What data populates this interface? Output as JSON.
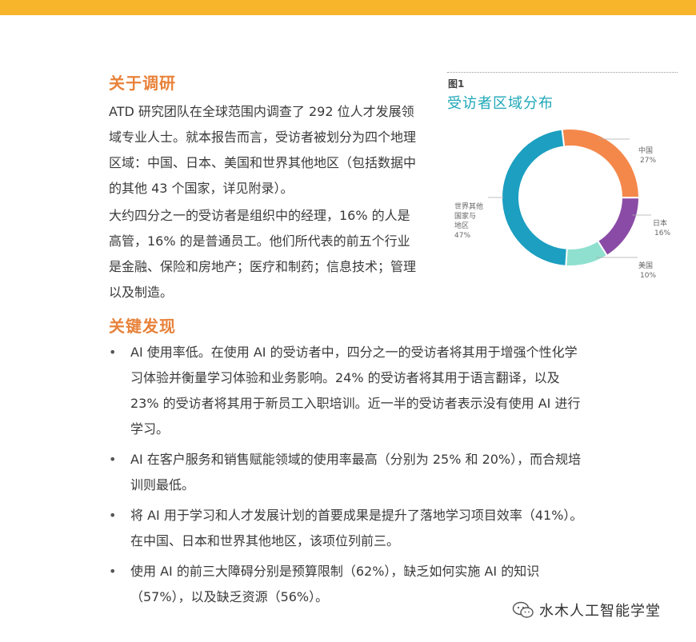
{
  "about": {
    "heading": "关于调研",
    "paragraph1": "ATD 研究团队在全球范围内调查了 292 位人才发展领域专业人士。就本报告而言，受访者被划分为四个地理区域：中国、日本、美国和世界其他地区（包括数据中的其他 43 个国家，详见附录）。",
    "paragraph2": "大约四分之一的受访者是组织中的经理，16% 的人是高管，16% 的是普通员工。他们所代表的前五个行业是金融、保险和房地产；医疗和制药；信息技术；管理以及制造。"
  },
  "figure": {
    "label": "图1",
    "title": "受访者区域分布"
  },
  "chart_data": {
    "type": "pie",
    "donut": true,
    "title": "受访者区域分布",
    "slices": [
      {
        "name": "中国",
        "value": 27,
        "label": "27%",
        "color": "#f4884a"
      },
      {
        "name": "日本",
        "value": 16,
        "label": "16%",
        "color": "#8a4ba6"
      },
      {
        "name": "美国",
        "value": 10,
        "label": "10%",
        "color": "#8fe0cf"
      },
      {
        "name": "世界其他国家与地区",
        "value": 47,
        "label": "47%",
        "color": "#1c9fc0"
      }
    ],
    "legend_lines": {
      "china": [
        "中国",
        "27%"
      ],
      "japan": [
        "日本",
        "16%"
      ],
      "usa": [
        "美国",
        "10%"
      ],
      "rest": [
        "世界其他",
        "国家与",
        "地区",
        "47%"
      ]
    }
  },
  "findings": {
    "heading": "关键发现",
    "bullet_symbol": "•",
    "items": [
      "AI 使用率低。在使用 AI 的受访者中，四分之一的受访者将其用于增强个性化学习体验并衡量学习体验和业务影响。24% 的受访者将其用于语言翻译，以及 23% 的受访者将其用于新员工入职培训。近一半的受访者表示没有使用 AI 进行学习。",
      "AI 在客户服务和销售赋能领域的使用率最高（分别为 25% 和 20%），而合规培训则最低。",
      "将 AI 用于学习和人才发展计划的首要成果是提升了落地学习项目效率（41%）。在中国、日本和世界其他地区，该项位列前三。",
      "使用 AI 的前三大障碍分别是预算限制（62%），缺乏如何实施 AI 的知识（57%），以及缺乏资源（56%）。"
    ]
  },
  "watermark": {
    "text": "水木人工智能学堂",
    "icon": "wechat-icon"
  }
}
